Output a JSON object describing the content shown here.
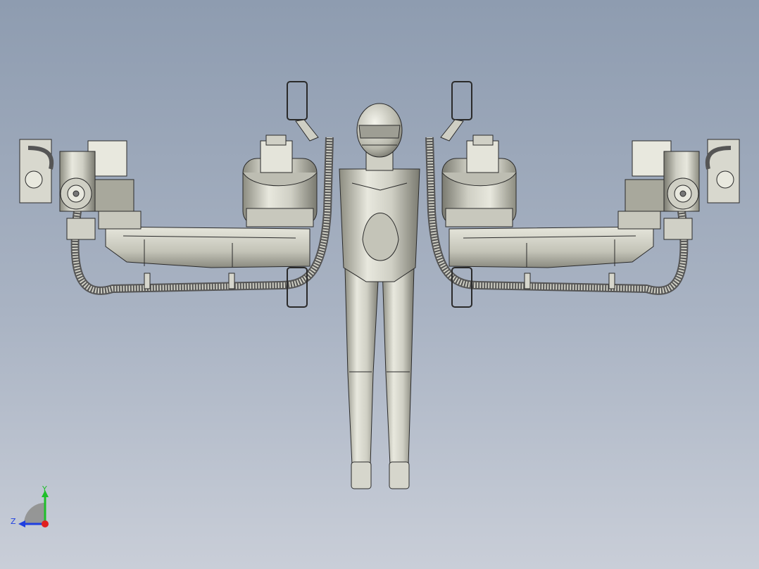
{
  "view": {
    "background_top": "#8e9cb0",
    "background_bottom": "#c9ced8",
    "model_fill": "#d6d6cc",
    "model_edge": "#2a2a2a"
  },
  "triad": {
    "y_label": "Y",
    "z_label": "Z",
    "y_color": "#1fbf2a",
    "z_color": "#1f3fe0",
    "x_color": "#e01f1f"
  }
}
